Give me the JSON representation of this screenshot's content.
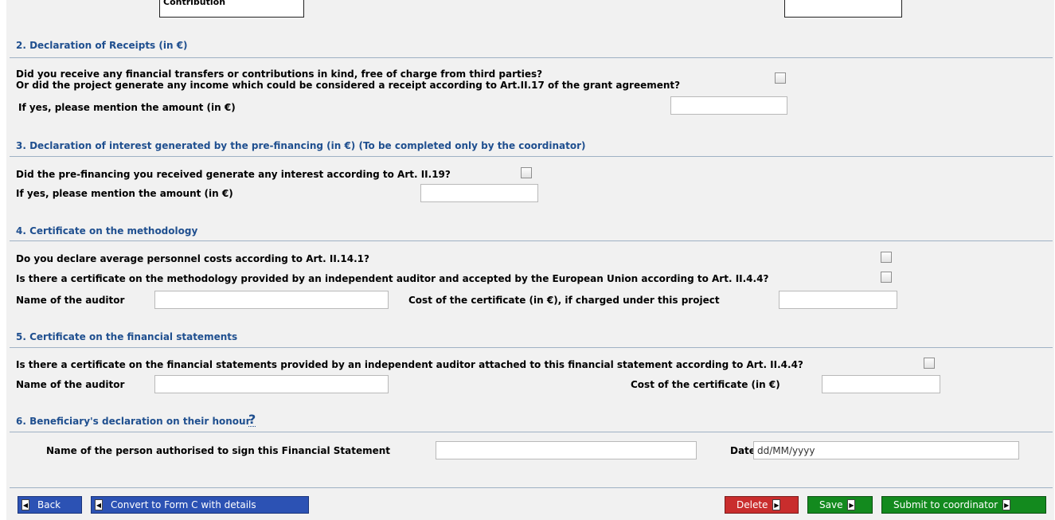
{
  "top": {
    "left_field_text": "Contribution"
  },
  "sections": {
    "receipts": {
      "title": "2. Declaration of Receipts (in €)",
      "question_line1": "Did you receive any financial transfers or contributions in kind, free of charge from third parties?",
      "question_line2": "Or did the project generate any income which could be considered a receipt according to Art.II.17 of the grant agreement?",
      "amount_label": "If yes, please mention the amount (in €)",
      "amount_value": ""
    },
    "interest": {
      "title": "3. Declaration of interest generated by the pre-financing (in €) (To be completed only by the coordinator)",
      "question": "Did the pre-financing you received generate any interest according to Art. II.19?",
      "amount_label": "If yes, please mention the amount (in €)",
      "amount_value": ""
    },
    "methodology": {
      "title": "4. Certificate on the methodology",
      "q1": "Do you declare average personnel costs according to Art. II.14.1?",
      "q2": "Is there a certificate on the methodology provided by an independent auditor and accepted by the European Union according to Art. II.4.4?",
      "auditor_label": "Name of the auditor",
      "auditor_value": "",
      "cost_label": "Cost of the certificate (in €), if charged under this project",
      "cost_value": ""
    },
    "financial": {
      "title": "5. Certificate on the financial statements",
      "question": "Is there a certificate on the financial statements provided by an independent auditor attached to this financial statement according to Art. II.4.4?",
      "auditor_label": "Name of the auditor",
      "auditor_value": "",
      "cost_label": "Cost of the certificate (in €)",
      "cost_value": ""
    },
    "honour": {
      "title": "6.  Beneficiary's declaration on their honour",
      "help": "?",
      "signer_label": "Name of the person authorised to sign this Financial Statement",
      "signer_value": "",
      "date_label": "Date",
      "date_placeholder": "dd/MM/yyyy"
    }
  },
  "buttons": {
    "back": "Back",
    "convert": "Convert to Form C with details",
    "delete": "Delete",
    "save": "Save",
    "submit": "Submit to coordinator"
  },
  "colors": {
    "section_title": "#1f4f8f",
    "button_blue": "#2c52b4",
    "button_red": "#c92d2d",
    "button_green": "#138a1e"
  },
  "icons": {
    "back_arrow": "triangle-left",
    "forward_arrow": "triangle-right"
  }
}
